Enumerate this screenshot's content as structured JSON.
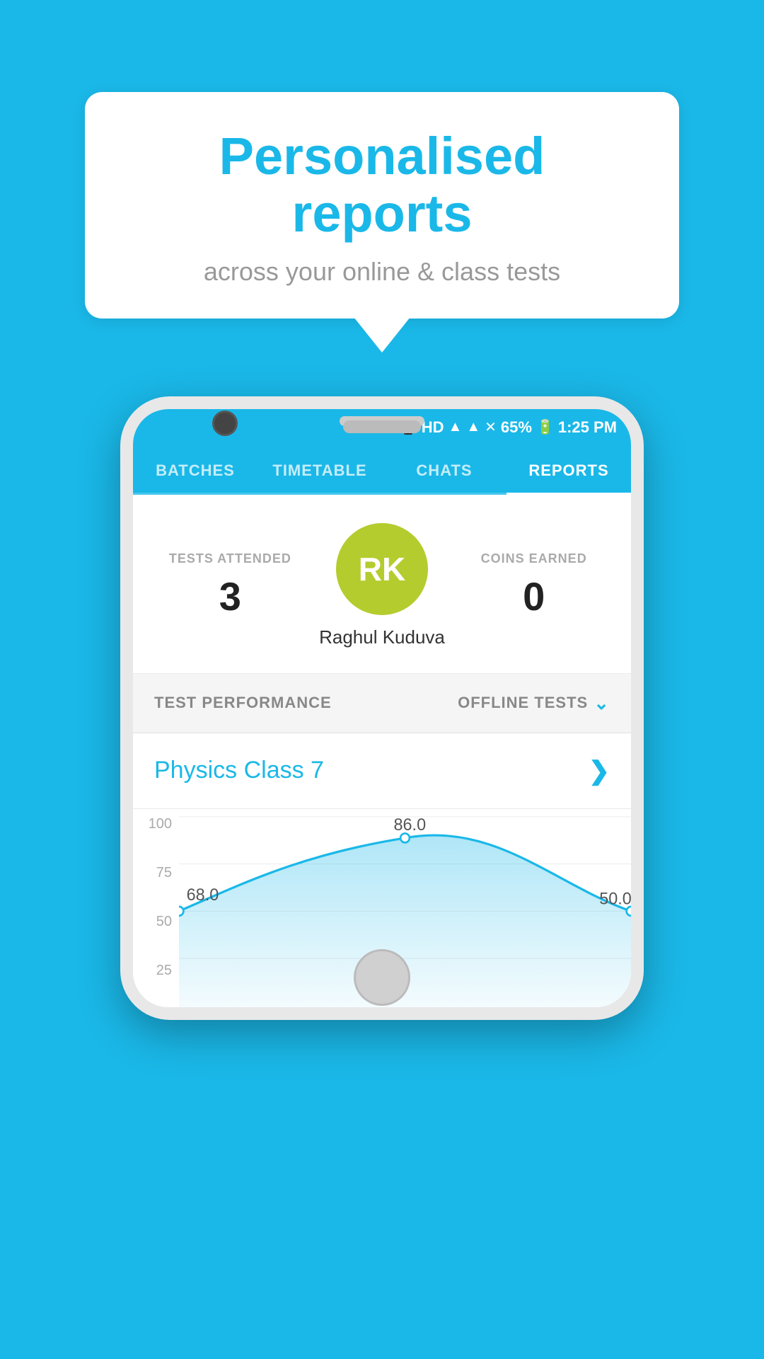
{
  "tooltip": {
    "title": "Personalised reports",
    "subtitle": "across your online & class tests"
  },
  "statusBar": {
    "time": "1:25 PM",
    "battery": "65%"
  },
  "navTabs": [
    {
      "label": "BATCHES",
      "active": false
    },
    {
      "label": "TIMETABLE",
      "active": false
    },
    {
      "label": "CHATS",
      "active": false
    },
    {
      "label": "REPORTS",
      "active": true
    }
  ],
  "profile": {
    "testsAttendedLabel": "TESTS ATTENDED",
    "testsAttendedValue": "3",
    "coinsEarnedLabel": "COINS EARNED",
    "coinsEarnedValue": "0",
    "avatarInitials": "RK",
    "avatarName": "Raghul Kuduva"
  },
  "testPerformance": {
    "label": "TEST PERFORMANCE",
    "filterLabel": "OFFLINE TESTS"
  },
  "classRow": {
    "className": "Physics Class 7"
  },
  "chart": {
    "yLabels": [
      "100",
      "75",
      "50",
      "25"
    ],
    "dataPoints": [
      {
        "label": "68.0",
        "value": 68
      },
      {
        "label": "86.0",
        "value": 86
      },
      {
        "label": "50.0",
        "value": 50
      }
    ]
  }
}
